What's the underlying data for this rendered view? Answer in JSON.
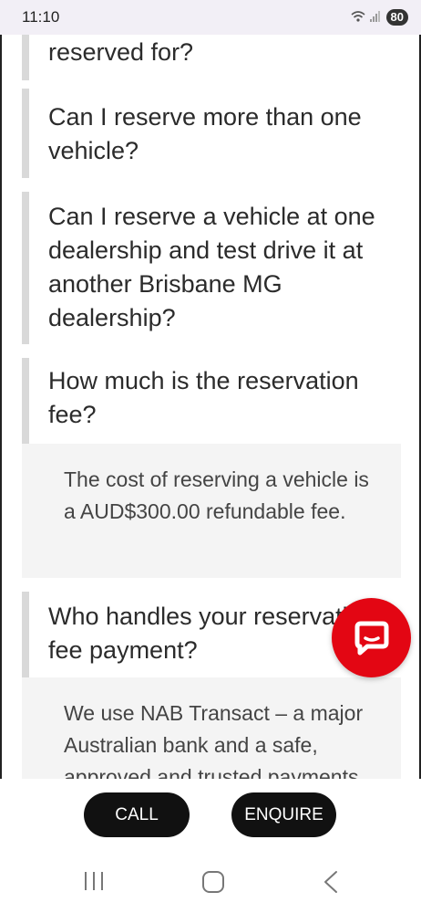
{
  "status_bar": {
    "time": "11:10",
    "battery": "80"
  },
  "faq": {
    "items": [
      {
        "question": "reserved for?"
      },
      {
        "question": "Can I reserve more than one vehicle?"
      },
      {
        "question": "Can I reserve a vehicle at one dealership and test drive it at another Brisbane MG dealership?"
      },
      {
        "question": "How much is the reservation fee?",
        "answer": "The cost of reserving a vehicle is a AUD$300.00 refundable fee."
      },
      {
        "question": "Who handles your reservation fee payment?",
        "answer": "We use NAB Transact – a major Australian bank and a safe, approved and trusted payments service to manage the"
      }
    ]
  },
  "actions": {
    "call_label": "CALL",
    "enquire_label": "ENQUIRE"
  },
  "colors": {
    "chat_fab": "#e30613",
    "pill": "#111111",
    "question_bar": "#d9d9d9",
    "answer_bg": "#f4f4f4"
  }
}
